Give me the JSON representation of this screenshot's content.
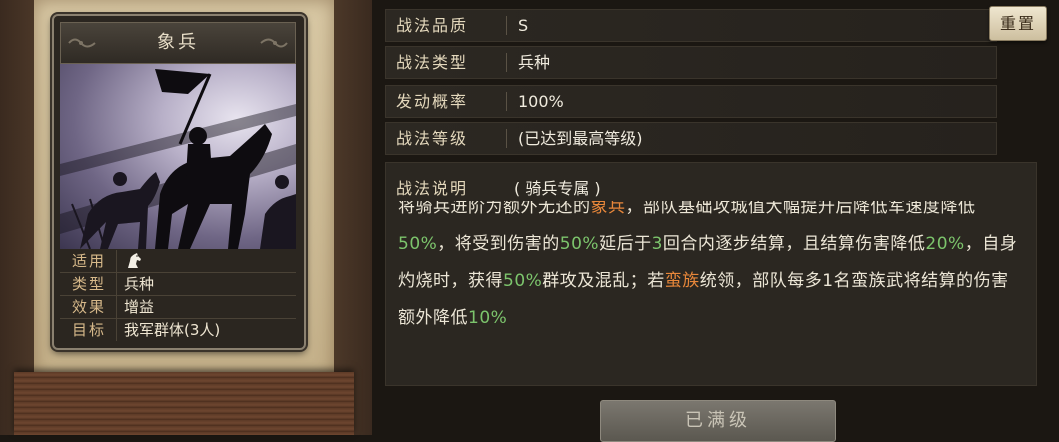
{
  "card": {
    "title": "象兵",
    "attributes": [
      {
        "key": "适用",
        "value": "",
        "icon": "cavalry-horse-icon"
      },
      {
        "key": "类型",
        "value": "兵种"
      },
      {
        "key": "效果",
        "value": "增益"
      },
      {
        "key": "目标",
        "value": "我军群体(3人)"
      }
    ]
  },
  "props": {
    "quality": {
      "key": "战法品质",
      "value": "S"
    },
    "type": {
      "key": "战法类型",
      "value": "兵种"
    },
    "rate": {
      "key": "发动概率",
      "value": "100%"
    },
    "level": {
      "key": "战法等级",
      "value": "(已达到最高等级)"
    }
  },
  "reset_label": "重置",
  "description": {
    "head": "战法说明",
    "tag": "( 骑兵专属 )",
    "segments": [
      {
        "text": "将骑兵进阶为额外无还的",
        "style": "plain"
      },
      {
        "text": "象兵",
        "style": "orange"
      },
      {
        "text": "，部队基础攻城值大幅提升后降低",
        "style": "plain"
      },
      {
        "text": "军速度降低",
        "style": "plain"
      },
      {
        "text": "50%",
        "style": "green"
      },
      {
        "text": "，将受到伤害的",
        "style": "plain"
      },
      {
        "text": "50%",
        "style": "green"
      },
      {
        "text": "延后于",
        "style": "plain"
      },
      {
        "text": "3",
        "style": "green"
      },
      {
        "text": "回合内逐步结算，且结算伤害降低",
        "style": "plain"
      },
      {
        "text": "20%",
        "style": "green"
      },
      {
        "text": "，自身灼烧时，获得",
        "style": "plain"
      },
      {
        "text": "50%",
        "style": "green"
      },
      {
        "text": "群攻及混乱；若",
        "style": "plain"
      },
      {
        "text": "蛮族",
        "style": "orange"
      },
      {
        "text": "统领，部队每多1名蛮族武将结算的伤害额外降低",
        "style": "plain"
      },
      {
        "text": "10%",
        "style": "green"
      }
    ]
  },
  "maxed_label": "已满级",
  "colors": {
    "highlight_green": "#7cc46c",
    "highlight_orange": "#e8873a",
    "panel_bg": "#2b2721"
  }
}
